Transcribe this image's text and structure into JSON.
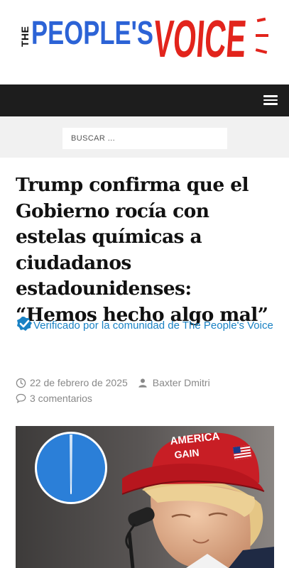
{
  "logo": {
    "the": "THE",
    "peoples": "PEOPLE'S",
    "voice": "VOICE"
  },
  "nav": {
    "menu_icon": "hamburger-icon"
  },
  "search": {
    "placeholder": "BUSCAR ..."
  },
  "article": {
    "title": "Trump confirma que el Gobierno rocía con estelas químicas a ciudadanos estadounidenses: “Hemos hecho algo mal”",
    "verified_text": "Verificado por la comunidad de The People's Voice",
    "date": "22 de febrero de 2025",
    "author": "Baxter Dmitri",
    "comments": "3 comentarios",
    "image": {
      "hat_line1": "AMERICA",
      "hat_line2": "GAIN"
    }
  },
  "colors": {
    "logo_blue": "#2c63d6",
    "logo_red": "#e2241c",
    "navbar": "#1d1d1d",
    "link": "#1a82c4"
  }
}
